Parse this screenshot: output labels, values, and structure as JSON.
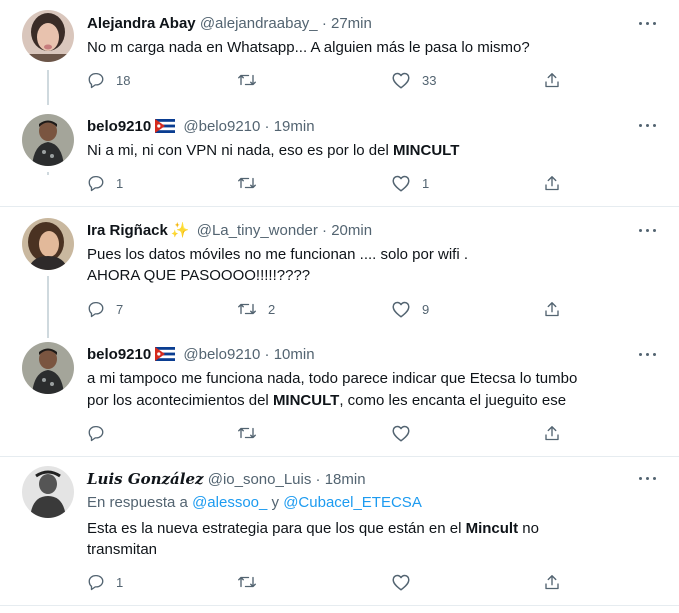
{
  "tweets": [
    {
      "name": "Alejandra Abay",
      "handle": "@alejandraabay_",
      "dot": "·",
      "time": "27min",
      "text": "No m carga nada en Whatsapp... A alguien más le pasa lo mismo?",
      "replies": "18",
      "retweets": "",
      "likes": "33"
    },
    {
      "name": "belo9210",
      "handle": "@belo9210",
      "dot": "·",
      "time": "19min",
      "text_pre": "Ni a mi, ni con VPN ni nada, eso es por lo del ",
      "text_bold": "MINCULT",
      "replies": "1",
      "retweets": "",
      "likes": "1"
    },
    {
      "name": "Ira Rigñack",
      "emoji": "✨",
      "handle": "@La_tiny_wonder",
      "dot": "·",
      "time": "20min",
      "text_line1": "Pues los datos móviles no me funcionan .... solo por wifi .",
      "text_line2": "AHORA QUE PASOOOO!!!!!????",
      "replies": "7",
      "retweets": "2",
      "likes": "9"
    },
    {
      "name": "belo9210",
      "handle": "@belo9210",
      "dot": "·",
      "time": "10min",
      "text_line1": "a mi tampoco me funciona nada, todo parece indicar que Etecsa lo tumbo",
      "text_line2_pre": "por los acontecimientos del ",
      "text_line2_bold": "MINCULT",
      "text_line2_post": ", como les encanta el jueguito ese",
      "replies": "",
      "retweets": "",
      "likes": ""
    },
    {
      "name": "𝕷𝖚𝖎𝖘 𝕲𝖔𝖓𝖟á𝖑𝖊𝖟",
      "name_display": "Luis González",
      "handle": "@io_sono_Luis",
      "dot": "·",
      "time": "18min",
      "reply_prefix": "En respuesta a ",
      "reply_user1": "@alessoo_",
      "reply_and": " y ",
      "reply_user2": "@Cubacel_ETECSA",
      "text_line1_pre": "Esta es la nueva estrategia para que los que están en el ",
      "text_line1_bold": "Mincult",
      "text_line1_post": " no",
      "text_line2": "transmitan",
      "replies": "1",
      "retweets": "",
      "likes": ""
    }
  ],
  "colors": {
    "text": "#0f1419",
    "muted": "#536471",
    "link": "#1d9bf0",
    "separator": "#e6ecf0",
    "thread_line": "#cfd9de"
  },
  "icons": [
    "reply-icon",
    "retweet-icon",
    "like-icon",
    "share-icon",
    "more-icon",
    "cuba-flag-icon",
    "sparkles-icon"
  ]
}
